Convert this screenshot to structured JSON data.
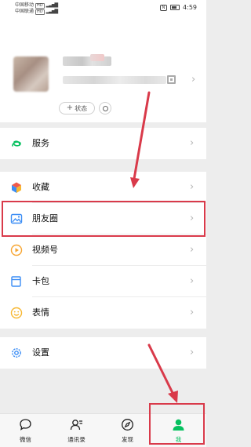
{
  "status_bar": {
    "carrier1": "中国移动",
    "carrier2": "中国联通",
    "tag": "HD",
    "nfc": "N",
    "time": "4:59"
  },
  "profile": {
    "status_label": "状态",
    "status_plus": "+"
  },
  "menu": [
    {
      "label": "服务",
      "icon": "wallet-icon"
    },
    {
      "label": "收藏",
      "icon": "cube-icon"
    },
    {
      "label": "朋友圈",
      "icon": "photo-icon"
    },
    {
      "label": "视频号",
      "icon": "play-icon"
    },
    {
      "label": "卡包",
      "icon": "card-icon"
    },
    {
      "label": "表情",
      "icon": "smile-icon"
    },
    {
      "label": "设置",
      "icon": "gear-icon"
    }
  ],
  "tabs": [
    {
      "label": "微信",
      "icon": "chat-icon"
    },
    {
      "label": "通讯录",
      "icon": "contacts-icon"
    },
    {
      "label": "发现",
      "icon": "compass-icon"
    },
    {
      "label": "我",
      "icon": "person-icon",
      "active": true
    }
  ],
  "colors": {
    "accent": "#07c160",
    "annotation": "#d93a4a",
    "background": "#ededed"
  }
}
